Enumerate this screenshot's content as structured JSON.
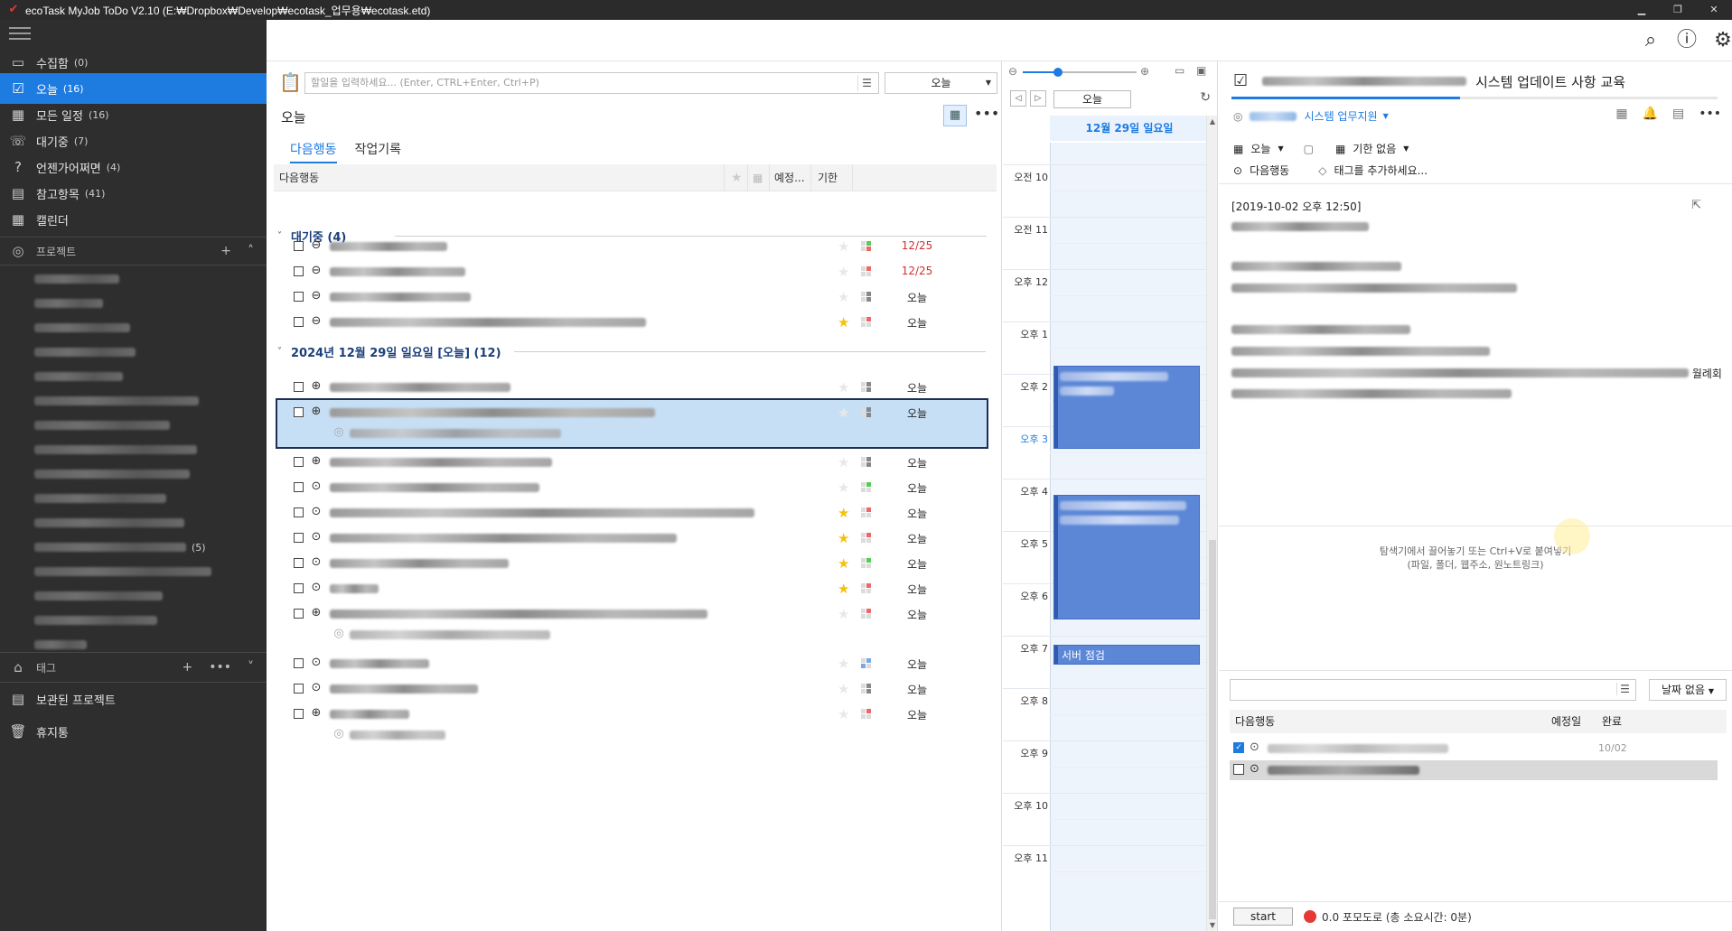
{
  "window": {
    "title": "ecoTask MyJob ToDo V2.10 (E:₩Dropbox₩Develop₩ecotask_업무용₩ecotask.etd)"
  },
  "sidebar": {
    "items": [
      {
        "label": "수집함",
        "count": "(0)",
        "icon": "inbox-icon"
      },
      {
        "label": "오늘",
        "count": "(16)",
        "icon": "calendar-check-icon",
        "active": true
      },
      {
        "label": "모든 일정",
        "count": "(16)",
        "icon": "calendar-icon"
      },
      {
        "label": "대기중",
        "count": "(7)",
        "icon": "phone-icon"
      },
      {
        "label": "언젠가어쩌면",
        "count": "(4)",
        "icon": "question-icon"
      },
      {
        "label": "참고항목",
        "count": "(41)",
        "icon": "document-icon"
      },
      {
        "label": "캘린더",
        "count": "",
        "icon": "calendar-grid-icon"
      }
    ],
    "projects_label": "프로젝트",
    "project_count_visible": "(5)",
    "tags_label": "태그",
    "archived_label": "보관된 프로젝트",
    "trash_label": "휴지통"
  },
  "list": {
    "input_placeholder": "할일을 입력하세요... (Enter, CTRL+Enter, Ctrl+P)",
    "date_select": "오늘",
    "view_title": "오늘",
    "tabs": [
      "다음행동",
      "작업기록"
    ],
    "columns": {
      "name": "다음행동",
      "due_plan": "예정...",
      "deadline": "기한"
    },
    "groups": [
      {
        "label": "대기중 (4)"
      },
      {
        "label": "2024년 12월 29일 일요일 [오늘] (12)"
      }
    ],
    "due_labels": [
      "12/25",
      "12/25",
      "오늘",
      "오늘",
      "오늘",
      "오늘",
      "오늘",
      "오늘",
      "오늘",
      "오늘",
      "오늘",
      "오늘",
      "오늘",
      "오늘",
      "오늘",
      "오늘"
    ]
  },
  "calendar": {
    "today_button": "오늘",
    "day_header": "12월 29일 일요일",
    "hours": [
      "오전 10",
      "오전 11",
      "오후 12",
      "오후 1",
      "오후 2",
      "오후 3",
      "오후 4",
      "오후 5",
      "오후 6",
      "오후 7",
      "오후 8",
      "오후 9",
      "오후 10",
      "오후 11"
    ],
    "events": [
      {
        "label": ""
      },
      {
        "label": ""
      },
      {
        "label": "서버 점검"
      }
    ]
  },
  "detail": {
    "title": "시스템 업데이트 사항 교육",
    "project": "시스템 업무지원",
    "schedule": "오늘",
    "deadline": "기한 없음",
    "status": "다음행동",
    "tag_placeholder": "태그를 추가하세요...",
    "note_timestamp": "[2019-10-02 오후 12:50]",
    "note_visible_word": "월례회",
    "drop_hint_1": "탐색기에서 끌어놓기 또는 Ctrl+V로 붙여넣기",
    "drop_hint_2": "(파일, 폴더, 웹주소, 원노트링크)",
    "sub_select": "날짜 없음",
    "sub_columns": {
      "name": "다음행동",
      "plan": "예정일",
      "done": "완료"
    },
    "sub_done_date": "10/02",
    "start_button": "start",
    "pomodoro": "0.0 포모도로 (총 소요시간: 0분)",
    "progress": 0.47
  },
  "colors": {
    "accent": "#1e7be0",
    "sidebar_bg": "#2e2e2e",
    "event_bg": "#5b87d6",
    "star": "#f4c20d",
    "overdue": "#d32f2f"
  }
}
